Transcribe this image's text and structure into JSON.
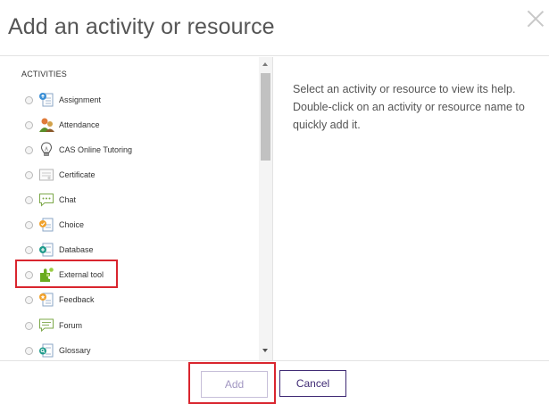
{
  "dialog": {
    "title": "Add an activity or resource",
    "help_text": "Select an activity or resource to view its help. Double-click on an activity or resource name to quickly add it."
  },
  "list": {
    "section_label": "ACTIVITIES",
    "items": [
      {
        "label": "Assignment",
        "icon": "assignment-icon"
      },
      {
        "label": "Attendance",
        "icon": "attendance-icon"
      },
      {
        "label": "CAS Online Tutoring",
        "icon": "lightbulb-icon"
      },
      {
        "label": "Certificate",
        "icon": "certificate-icon"
      },
      {
        "label": "Chat",
        "icon": "chat-icon"
      },
      {
        "label": "Choice",
        "icon": "choice-icon"
      },
      {
        "label": "Database",
        "icon": "database-icon"
      },
      {
        "label": "External tool",
        "icon": "puzzle-icon"
      },
      {
        "label": "Feedback",
        "icon": "feedback-icon"
      },
      {
        "label": "Forum",
        "icon": "forum-icon"
      },
      {
        "label": "Glossary",
        "icon": "glossary-icon"
      }
    ]
  },
  "buttons": {
    "add_label": "Add",
    "cancel_label": "Cancel"
  },
  "colors": {
    "highlight": "#d9252e",
    "cancel_border": "#3f2a74",
    "add_disabled_text": "#a297c2"
  }
}
